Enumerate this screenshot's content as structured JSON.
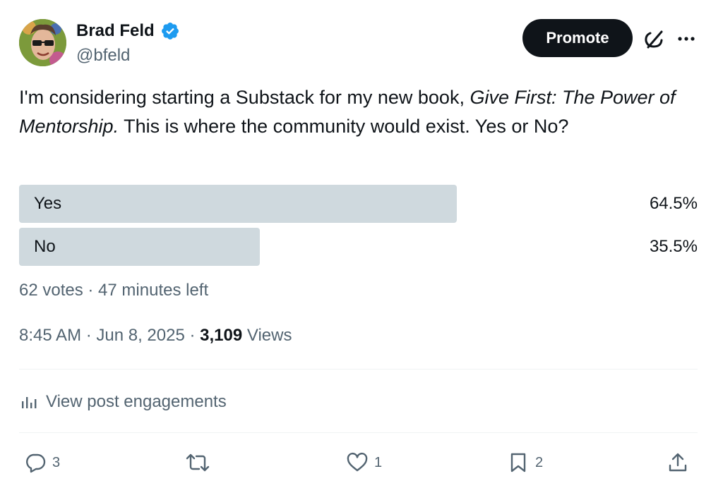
{
  "author": {
    "name": "Brad Feld",
    "handle": "@bfeld",
    "verified_color": "#1d9bf0"
  },
  "header": {
    "promote_label": "Promote",
    "grok_icon": "grok-icon",
    "more_icon": "more-icon"
  },
  "tweet": {
    "text_part1": "I'm considering starting a Substack for my new book, ",
    "text_italic": "Give First: The Power of Mentorship.",
    "text_part2": " This is where the community would exist. Yes or No?"
  },
  "poll": {
    "options": [
      {
        "label": "Yes",
        "percent_label": "64.5%",
        "fraction": 0.645
      },
      {
        "label": "No",
        "percent_label": "35.5%",
        "fraction": 0.355
      }
    ],
    "meta": "62 votes · 47 minutes left",
    "bar_color": "#cfd9de"
  },
  "timestamp": {
    "time": "8:45 AM · Jun 8, 2025 · ",
    "views_count": "3,109",
    "views_label": " Views"
  },
  "engagements": {
    "label": "View post engagements"
  },
  "actions": {
    "reply_count": "3",
    "like_count": "1",
    "bookmark_count": "2"
  }
}
